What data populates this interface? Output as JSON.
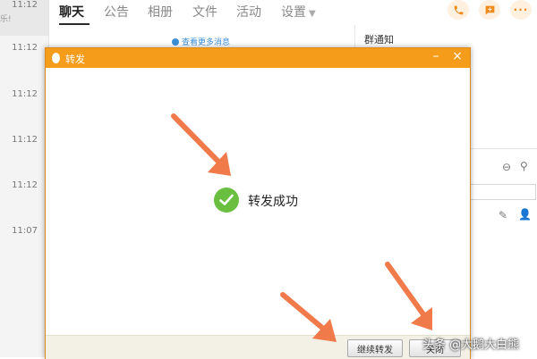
{
  "left_list": {
    "rows": [
      {
        "time": "11:12",
        "snippet": "乐!"
      },
      {
        "time": "11:12",
        "snippet": ""
      },
      {
        "time": "11:12",
        "snippet": ""
      },
      {
        "time": "11:12",
        "snippet": ""
      },
      {
        "time": "11:12",
        "snippet": ""
      },
      {
        "time": "11:07",
        "snippet": ""
      }
    ]
  },
  "tabs": [
    "聊天",
    "公告",
    "相册",
    "文件",
    "活动",
    "设置"
  ],
  "active_tab": "聊天",
  "view_more_label": "查看更多消息",
  "right_panel": {
    "notice_title": "群通知"
  },
  "dialog": {
    "title": "转发",
    "success_text": "转发成功",
    "continue_button": "继续转发",
    "close_button": "关闭"
  },
  "watermark": "头条 @大鹅大白熊",
  "colors": {
    "titlebar": "#f59c1a",
    "success_green": "#6abf40",
    "arrow": "#f07a4a",
    "accent_orange": "#f08a1c"
  }
}
